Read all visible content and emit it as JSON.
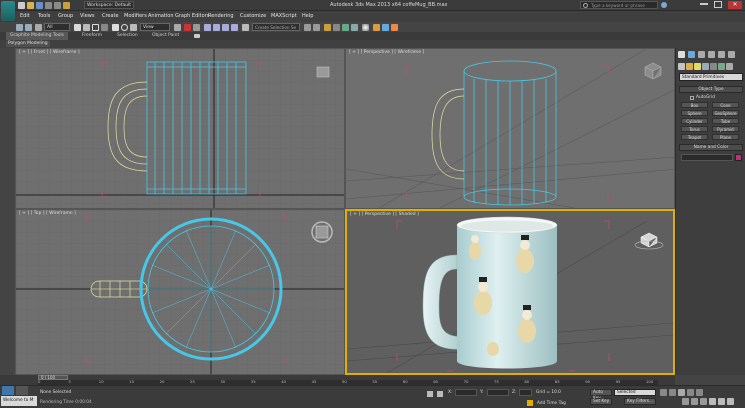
{
  "title_bar": {
    "workspace": "Workspace: Default",
    "doc_title": "Autodesk 3ds Max 2013 x64    coffeMug_BB.max",
    "search_placeholder": "Type a keyword or phrase"
  },
  "menu": [
    "Edit",
    "Tools",
    "Group",
    "Views",
    "Create",
    "Modifiers",
    "Animation",
    "Graph Editors",
    "Rendering",
    "Customize",
    "MAXScript",
    "Help"
  ],
  "toolbar": {
    "selection_filter": "All",
    "view_dropdown": "View",
    "named_set": "Create Selection Se"
  },
  "ribbon": {
    "tabs": [
      "Graphite Modeling Tools",
      "Freeform",
      "Selection",
      "Object Paint"
    ],
    "sub_label": "Polygon Modeling"
  },
  "viewports": {
    "front": "[ + ] [ Front ] [ Wireframe ]",
    "persp_wire": "[ + ] [ Perspective ] [ Wireframe ]",
    "top": "[ + ] [ Top ] [ Wireframe ]",
    "persp_shaded": "[ + ] [ Perspective ] [ Shaded ]"
  },
  "command_panel": {
    "dropdown": "Standard Primitives",
    "rollout_object_type": "Object Type",
    "autogrid": "AutoGrid",
    "buttons": [
      "Box",
      "Cone",
      "Sphere",
      "GeoSphere",
      "Cylinder",
      "Tube",
      "Torus",
      "Pyramid",
      "Teapot",
      "Plane"
    ],
    "rollout_name_color": "Name and Color"
  },
  "timeline": {
    "frame_counter": "0 / 100",
    "ticks": [
      "0",
      "5",
      "10",
      "15",
      "20",
      "25",
      "30",
      "35",
      "40",
      "45",
      "50",
      "55",
      "60",
      "65",
      "70",
      "75",
      "80",
      "85",
      "90",
      "95",
      "100"
    ]
  },
  "status": {
    "maxscript": "Welcome to M",
    "selection": "None Selected",
    "prompt": "Rendering Time 0:00:04",
    "x_label": "X:",
    "y_label": "Y:",
    "z_label": "Z:",
    "grid": "Grid = 10.0",
    "add_time_tag": "Add Time Tag",
    "auto_key": "Auto Key",
    "set_key": "Set Key",
    "selected_dd": "Selected",
    "key_filters": "Key Filters..."
  },
  "colors": {
    "wire_cyan": "#47c8e8",
    "wire_yellow": "#e4e4a0",
    "selection_yellow": "#e0b000",
    "bracket_red": "#c84a6c"
  }
}
